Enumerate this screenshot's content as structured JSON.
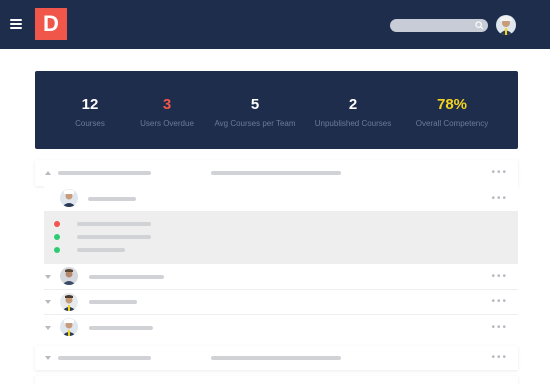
{
  "header": {
    "logo_letter": "D",
    "menu_icon": "hamburger-menu-icon",
    "search": {
      "placeholder": "",
      "icon": "search-icon"
    },
    "user_avatar": "user-avatar"
  },
  "stats": [
    {
      "value": "12",
      "label": "Courses",
      "color": "#ffffff"
    },
    {
      "value": "3",
      "label": "Users Overdue",
      "color": "#f0564a"
    },
    {
      "value": "5",
      "label": "Avg Courses per Team",
      "color": "#ffffff"
    },
    {
      "value": "2",
      "label": "Unpublished Courses",
      "color": "#ffffff"
    },
    {
      "value": "78%",
      "label": "Overall Competency",
      "color": "#f5d41d"
    }
  ],
  "list": {
    "more_icon": "more-dots-icon",
    "status_colors": {
      "overdue": "#f0564a",
      "complete": "#2ecc71"
    },
    "detail_statuses": [
      "overdue",
      "complete",
      "complete"
    ]
  },
  "colors": {
    "navy": "#1f2d4d",
    "brand": "#f0564a",
    "accent_yellow": "#f5d41d"
  }
}
